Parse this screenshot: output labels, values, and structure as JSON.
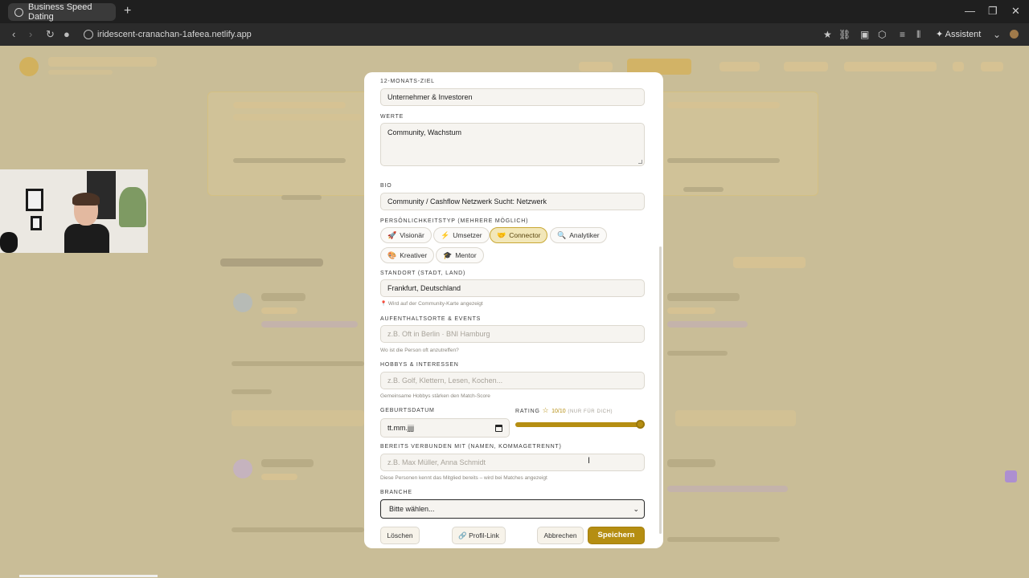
{
  "browser": {
    "tab_title": "Business Speed Dating",
    "new_tab_icon": "plus-icon",
    "url": "iridescent-cranachan-1afeea.netlify.app",
    "assistant_label": "Assistent"
  },
  "modal": {
    "goal": {
      "label": "12-Monats-Ziel",
      "value": "Unternehmer & Investoren"
    },
    "values": {
      "label": "Werte",
      "value": "Community, Wachstum"
    },
    "bio": {
      "label": "Bio",
      "value": "Community / Cashflow Netzwerk Sucht: Netzwerk"
    },
    "personality": {
      "label": "Persönlichkeitstyp (mehrere möglich)",
      "chips": [
        {
          "label": "Visionär",
          "icon": "🚀",
          "selected": false
        },
        {
          "label": "Umsetzer",
          "icon": "⚡",
          "selected": false
        },
        {
          "label": "Connector",
          "icon": "🤝",
          "selected": true
        },
        {
          "label": "Analytiker",
          "icon": "🔍",
          "selected": false
        },
        {
          "label": "Kreativer",
          "icon": "🎨",
          "selected": false
        },
        {
          "label": "Mentor",
          "icon": "🎓",
          "selected": false
        }
      ]
    },
    "location": {
      "label": "Standort (Stadt, Land)",
      "value": "Frankfurt, Deutschland",
      "hint": "Wird auf der Community-Karte angezeigt"
    },
    "places": {
      "label": "Aufenthaltsorte & Events",
      "placeholder": "z.B. Oft in Berlin · BNI Hamburg",
      "hint": "Wo ist die Person oft anzutreffen?"
    },
    "hobbies": {
      "label": "Hobbys & Interessen",
      "placeholder": "z.B. Golf, Klettern, Lesen, Kochen...",
      "hint": "Gemeinsame Hobbys stärken den Match-Score"
    },
    "birthday": {
      "label": "Geburtsdatum",
      "value": "tt.mm.jjjj"
    },
    "rating": {
      "label": "Rating",
      "value": "10/10",
      "note": "(nur für dich)",
      "level": 10,
      "max": 10
    },
    "connected": {
      "label": "Bereits verbunden mit (Namen, kommagetrennt)",
      "placeholder": "z.B. Max Müller, Anna Schmidt",
      "hint": "Diese Personen kennt das Mitglied bereits – wird bei Matches angezeigt"
    },
    "industry": {
      "label": "Branche",
      "value": "Bitte wählen..."
    },
    "buttons": {
      "delete": "Löschen",
      "profile_link": "Profil-Link",
      "cancel": "Abbrechen",
      "save": "Speichern"
    }
  },
  "colors": {
    "accent": "#b58e12",
    "chip_selected_bg": "#f2e7b9",
    "backdrop": "#bdb28f"
  }
}
